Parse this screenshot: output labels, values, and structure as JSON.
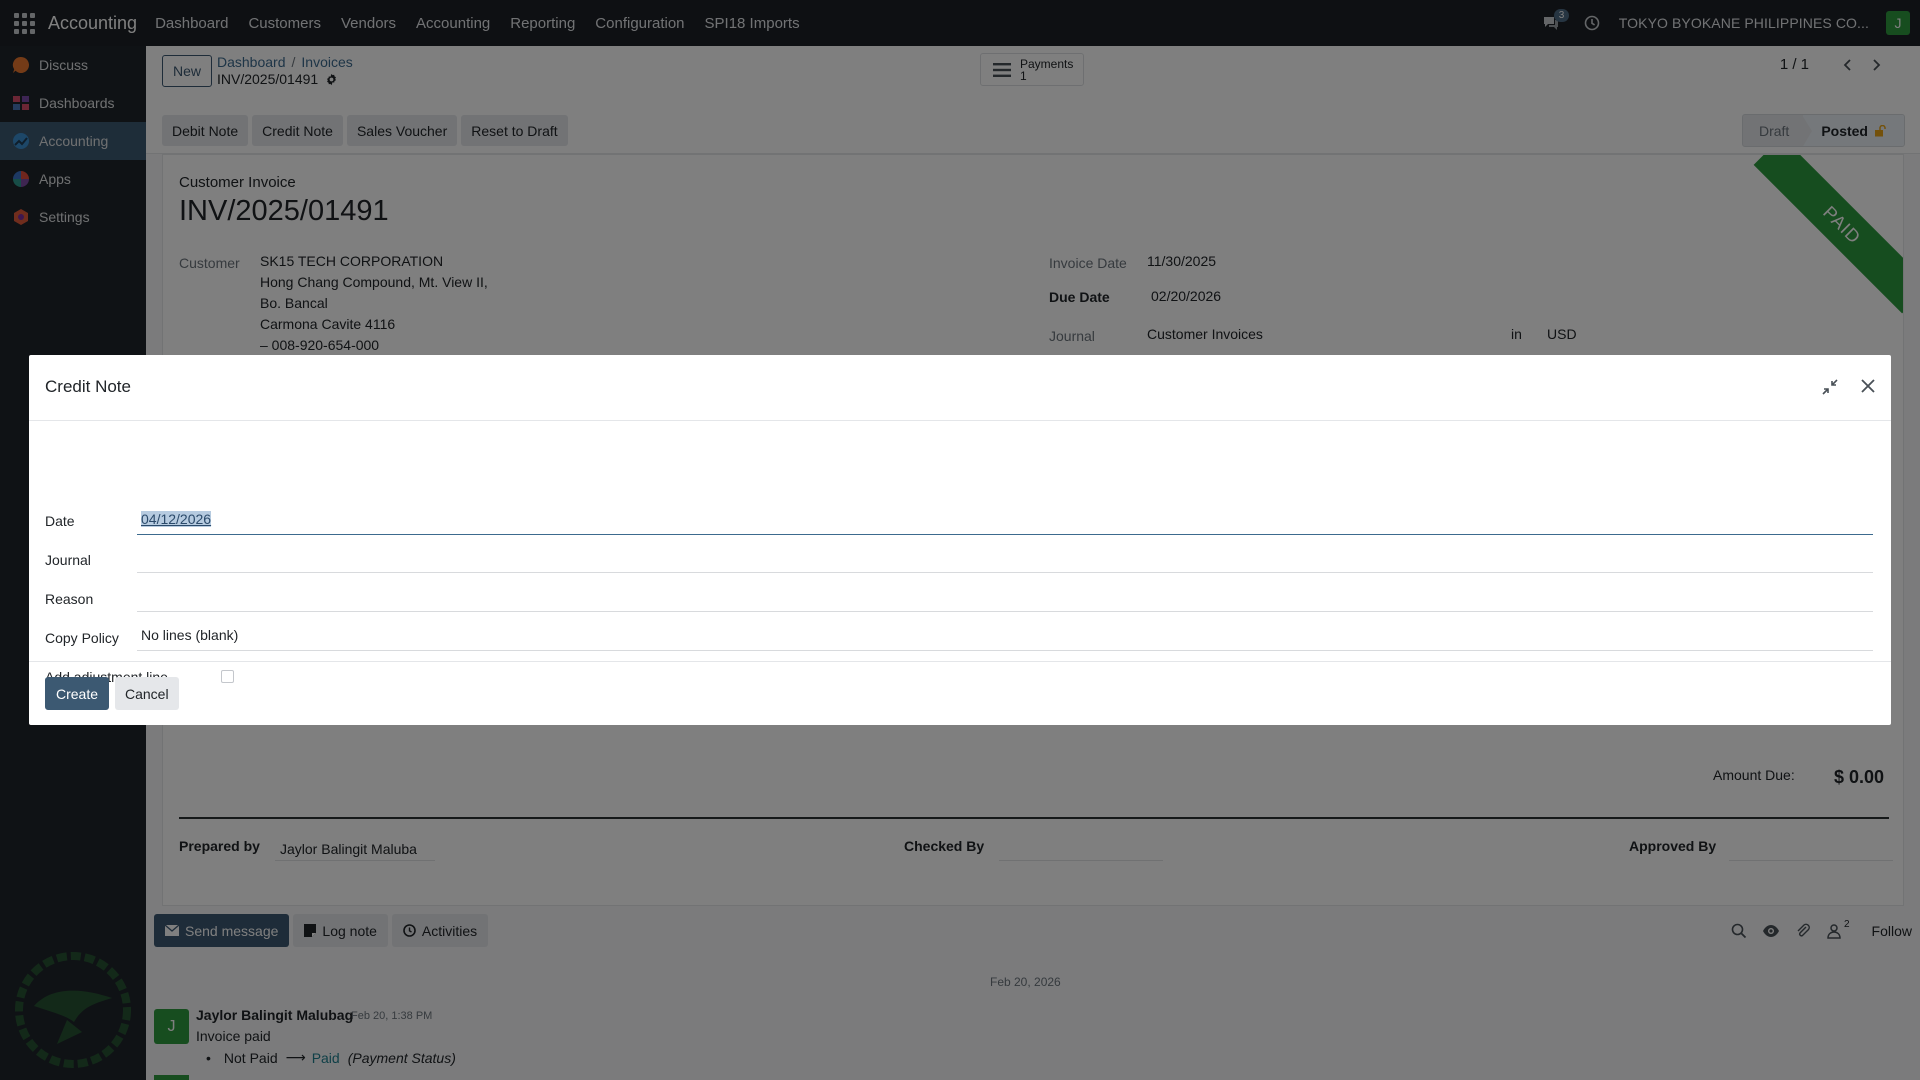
{
  "navbar": {
    "brand": "Accounting",
    "menu": [
      "Dashboard",
      "Customers",
      "Vendors",
      "Accounting",
      "Reporting",
      "Configuration",
      "SPI18 Imports"
    ],
    "messages_count": "3",
    "company": "TOKYO BYOKANE PHILIPPINES CO...",
    "user_initial": "J"
  },
  "sidebar": {
    "items": [
      {
        "label": "Discuss",
        "icon": "discuss-icon"
      },
      {
        "label": "Dashboards",
        "icon": "dashboards-icon"
      },
      {
        "label": "Accounting",
        "icon": "accounting-icon",
        "active": true
      },
      {
        "label": "Apps",
        "icon": "apps-icon"
      },
      {
        "label": "Settings",
        "icon": "settings-icon"
      }
    ]
  },
  "control_panel": {
    "new_label": "New",
    "breadcrumb": [
      "Dashboard",
      "Invoices"
    ],
    "record_name": "INV/2025/01491",
    "smart_button": {
      "label": "Payments",
      "count": "1"
    },
    "pager": "1 / 1",
    "actions": [
      "Debit Note",
      "Credit Note",
      "Sales Voucher",
      "Reset to Draft"
    ],
    "status_steps": [
      "Draft",
      "Posted"
    ],
    "status_active": "Posted"
  },
  "invoice": {
    "doc_type": "Customer Invoice",
    "number": "INV/2025/01491",
    "ribbon": "PAID",
    "customer_label": "Customer",
    "customer_lines": [
      "SK15 TECH CORPORATION",
      "Hong Chang Compound, Mt. View II,",
      "Bo. Bancal",
      "Carmona Cavite 4116",
      "– 008-920-654-000"
    ],
    "invoice_date_label": "Invoice Date",
    "invoice_date": "11/30/2025",
    "due_date_label": "Due Date",
    "due_date": "02/20/2026",
    "journal_label": "Journal",
    "journal": "Customer Invoices",
    "in_label": "in",
    "currency": "USD",
    "amount_due_label": "Amount Due:",
    "amount_due": "$ 0.00",
    "prepared_by_label": "Prepared by",
    "prepared_by": "Jaylor Balingit Maluba",
    "checked_by_label": "Checked By",
    "approved_by_label": "Approved By"
  },
  "chatter": {
    "send_message": "Send message",
    "log_note": "Log note",
    "activities": "Activities",
    "followers_count": "2",
    "follow": "Follow",
    "date_separator": "Feb 20, 2026",
    "message": {
      "avatar": "J",
      "author": "Jaylor Balingit Malubag",
      "time": "Feb 20, 1:38 PM",
      "body": "Invoice paid",
      "old_value": "Not Paid",
      "arrow": "⟶",
      "new_value": "Paid",
      "field": "(Payment Status)"
    }
  },
  "dialog": {
    "title": "Credit Note",
    "fields": {
      "date_label": "Date",
      "date_value": "04/12/2026",
      "journal_label": "Journal",
      "journal_value": "",
      "reason_label": "Reason",
      "reason_value": "",
      "copy_policy_label": "Copy Policy",
      "copy_policy_value": "No lines (blank)",
      "adjustment_label": "Add adjustment line"
    },
    "create_label": "Create",
    "cancel_label": "Cancel"
  },
  "colors": {
    "navbar_bg": "#1c2126",
    "primary": "#3c5972",
    "paid_ribbon": "#2d9a3e",
    "link": "#3c6a8e"
  }
}
